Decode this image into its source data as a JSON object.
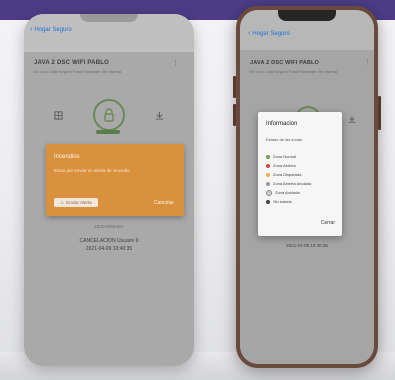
{
  "left_phone": {
    "back_label": "Hogar Seguro",
    "device_title": "JAVA 2 DSC WIFI PABLO",
    "device_subtitle": "En Lina Calle Seguro Panel Restante Ver Alarma",
    "alert": {
      "title": "Incendios",
      "message": "Estas por enviar un alerta de incendio",
      "send_label": "Enviar Alerta",
      "cancel_label": "Cancelar"
    },
    "status_label": "DESARMADO",
    "cancel_line": "CANCELACION Usuario 9",
    "date_line": "2021-04-09 10:40:35"
  },
  "right_phone": {
    "back_label": "Hogar Seguro",
    "device_title": "JAVA 2 DSC WIFI PABLO",
    "device_subtitle": "En Lina Calle Seguro Panel Restante Ver Alarma",
    "date_line": "2021-04-09 10:40:35",
    "dialog": {
      "title": "Informacion",
      "subtitle": "Estado de las zonas",
      "legend": [
        {
          "label": "Zona Normal",
          "color": "#6aa84f"
        },
        {
          "label": "Zona Abierta",
          "color": "#d24a3c"
        },
        {
          "label": "Zona Disparada",
          "color": "#e9b24a"
        },
        {
          "label": "Zona Abierta Anulada",
          "color": "#9a9a9a"
        },
        {
          "label": "Zona Anulada",
          "color": "#cfcfcf"
        },
        {
          "label": "Sin estado",
          "color": "#444444"
        }
      ],
      "close_label": "Cerrar"
    }
  },
  "colors": {
    "accent_blue": "#1e73d8",
    "alert_orange": "#d9913d",
    "lock_green": "#6a8a55",
    "top_strip": "#4c3c86"
  }
}
